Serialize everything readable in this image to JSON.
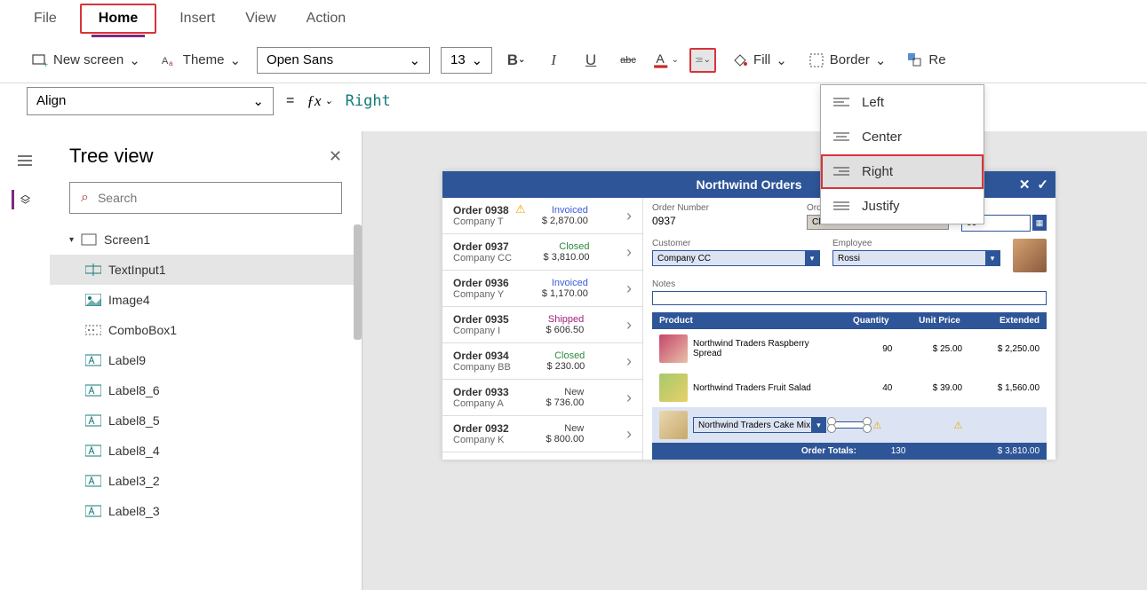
{
  "menu": {
    "items": [
      "File",
      "Home",
      "Insert",
      "View",
      "Action"
    ],
    "active": "Home"
  },
  "ribbon": {
    "new_screen": "New screen",
    "theme": "Theme",
    "font_name": "Open Sans",
    "font_size": "13",
    "fill": "Fill",
    "border": "Border",
    "reorder": "Re"
  },
  "property": {
    "name": "Align",
    "equals": "=",
    "formula": "Right"
  },
  "align_menu": {
    "options": [
      "Left",
      "Center",
      "Right",
      "Justify"
    ],
    "selected": "Right"
  },
  "tree": {
    "title": "Tree view",
    "search_placeholder": "Search",
    "root": "Screen1",
    "items": [
      "TextInput1",
      "Image4",
      "ComboBox1",
      "Label9",
      "Label8_6",
      "Label8_5",
      "Label8_4",
      "Label3_2",
      "Label8_3"
    ],
    "selected": "TextInput1"
  },
  "app": {
    "title": "Northwind Orders",
    "orders": [
      {
        "name": "Order 0938",
        "company": "Company T",
        "status": "Invoiced",
        "status_class": "invoiced",
        "price": "$ 2,870.00",
        "warn": true
      },
      {
        "name": "Order 0937",
        "company": "Company CC",
        "status": "Closed",
        "status_class": "closed",
        "price": "$ 3,810.00"
      },
      {
        "name": "Order 0936",
        "company": "Company Y",
        "status": "Invoiced",
        "status_class": "invoiced",
        "price": "$ 1,170.00"
      },
      {
        "name": "Order 0935",
        "company": "Company I",
        "status": "Shipped",
        "status_class": "shipped",
        "price": "$ 606.50"
      },
      {
        "name": "Order 0934",
        "company": "Company BB",
        "status": "Closed",
        "status_class": "closed",
        "price": "$ 230.00"
      },
      {
        "name": "Order 0933",
        "company": "Company A",
        "status": "New",
        "status_class": "new",
        "price": "$ 736.00"
      },
      {
        "name": "Order 0932",
        "company": "Company K",
        "status": "New",
        "status_class": "new",
        "price": "$ 800.00"
      }
    ],
    "detail": {
      "labels": {
        "order_number": "Order Number",
        "order_status": "Order Status",
        "order_date": "ate",
        "customer": "Customer",
        "employee": "Employee",
        "notes": "Notes"
      },
      "order_number": "0937",
      "order_status": "Closed",
      "order_date": "06",
      "customer": "Company CC",
      "employee": "Rossi",
      "notes": ""
    },
    "products": {
      "headers": {
        "product": "Product",
        "quantity": "Quantity",
        "unit_price": "Unit Price",
        "extended": "Extended"
      },
      "rows": [
        {
          "name": "Northwind Traders Raspberry Spread",
          "qty": "90",
          "unit": "$ 25.00",
          "ext": "$ 2,250.00",
          "img": "raspberry"
        },
        {
          "name": "Northwind Traders Fruit Salad",
          "qty": "40",
          "unit": "$ 39.00",
          "ext": "$ 1,560.00",
          "img": "fruit"
        }
      ],
      "new_row": {
        "name": "Northwind Traders Cake Mix"
      },
      "totals": {
        "label": "Order Totals:",
        "qty": "130",
        "ext": "$ 3,810.00"
      }
    }
  }
}
